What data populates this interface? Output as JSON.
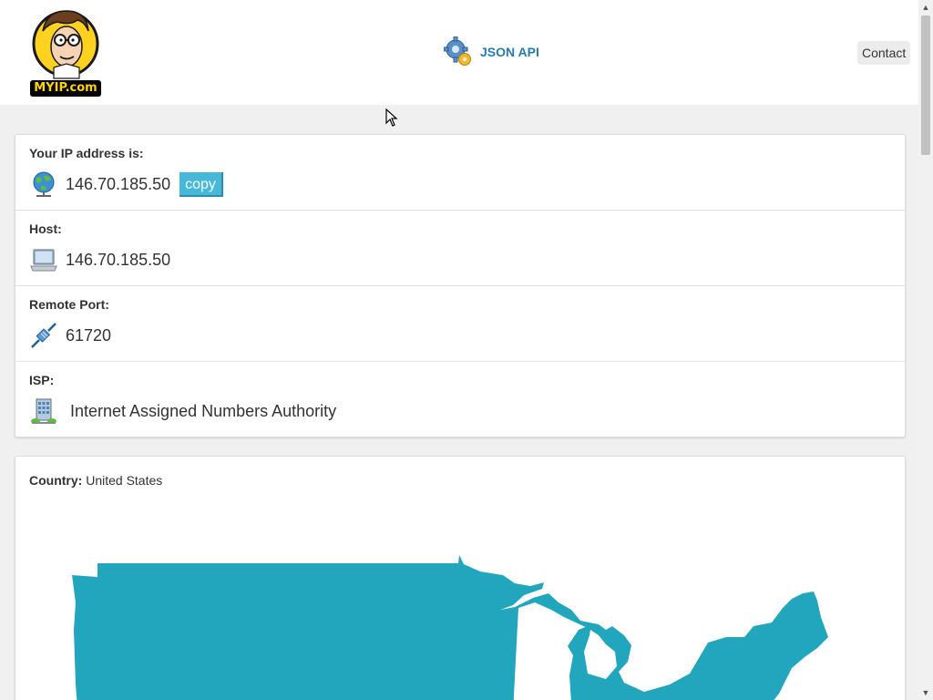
{
  "header": {
    "logo_text": "MYIP.com",
    "api_label": "JSON API",
    "contact_label": "Contact"
  },
  "ip_card": {
    "ip": {
      "title": "Your IP address is:",
      "value": "146.70.185.50",
      "copy_label": "copy",
      "icon": "globe-icon"
    },
    "host": {
      "title": "Host:",
      "value": "146.70.185.50",
      "icon": "laptop-icon"
    },
    "port": {
      "title": "Remote Port:",
      "value": "61720",
      "icon": "network-cable-icon"
    },
    "isp": {
      "title": "ISP:",
      "value": "Internet Assigned Numbers Authority",
      "icon": "building-icon"
    }
  },
  "country_card": {
    "label": "Country:",
    "value": "United States",
    "map_color": "#22a6bd"
  },
  "colors": {
    "accent": "#2a7ab0",
    "copy_button": "#46b8da",
    "map": "#22a6bd"
  }
}
